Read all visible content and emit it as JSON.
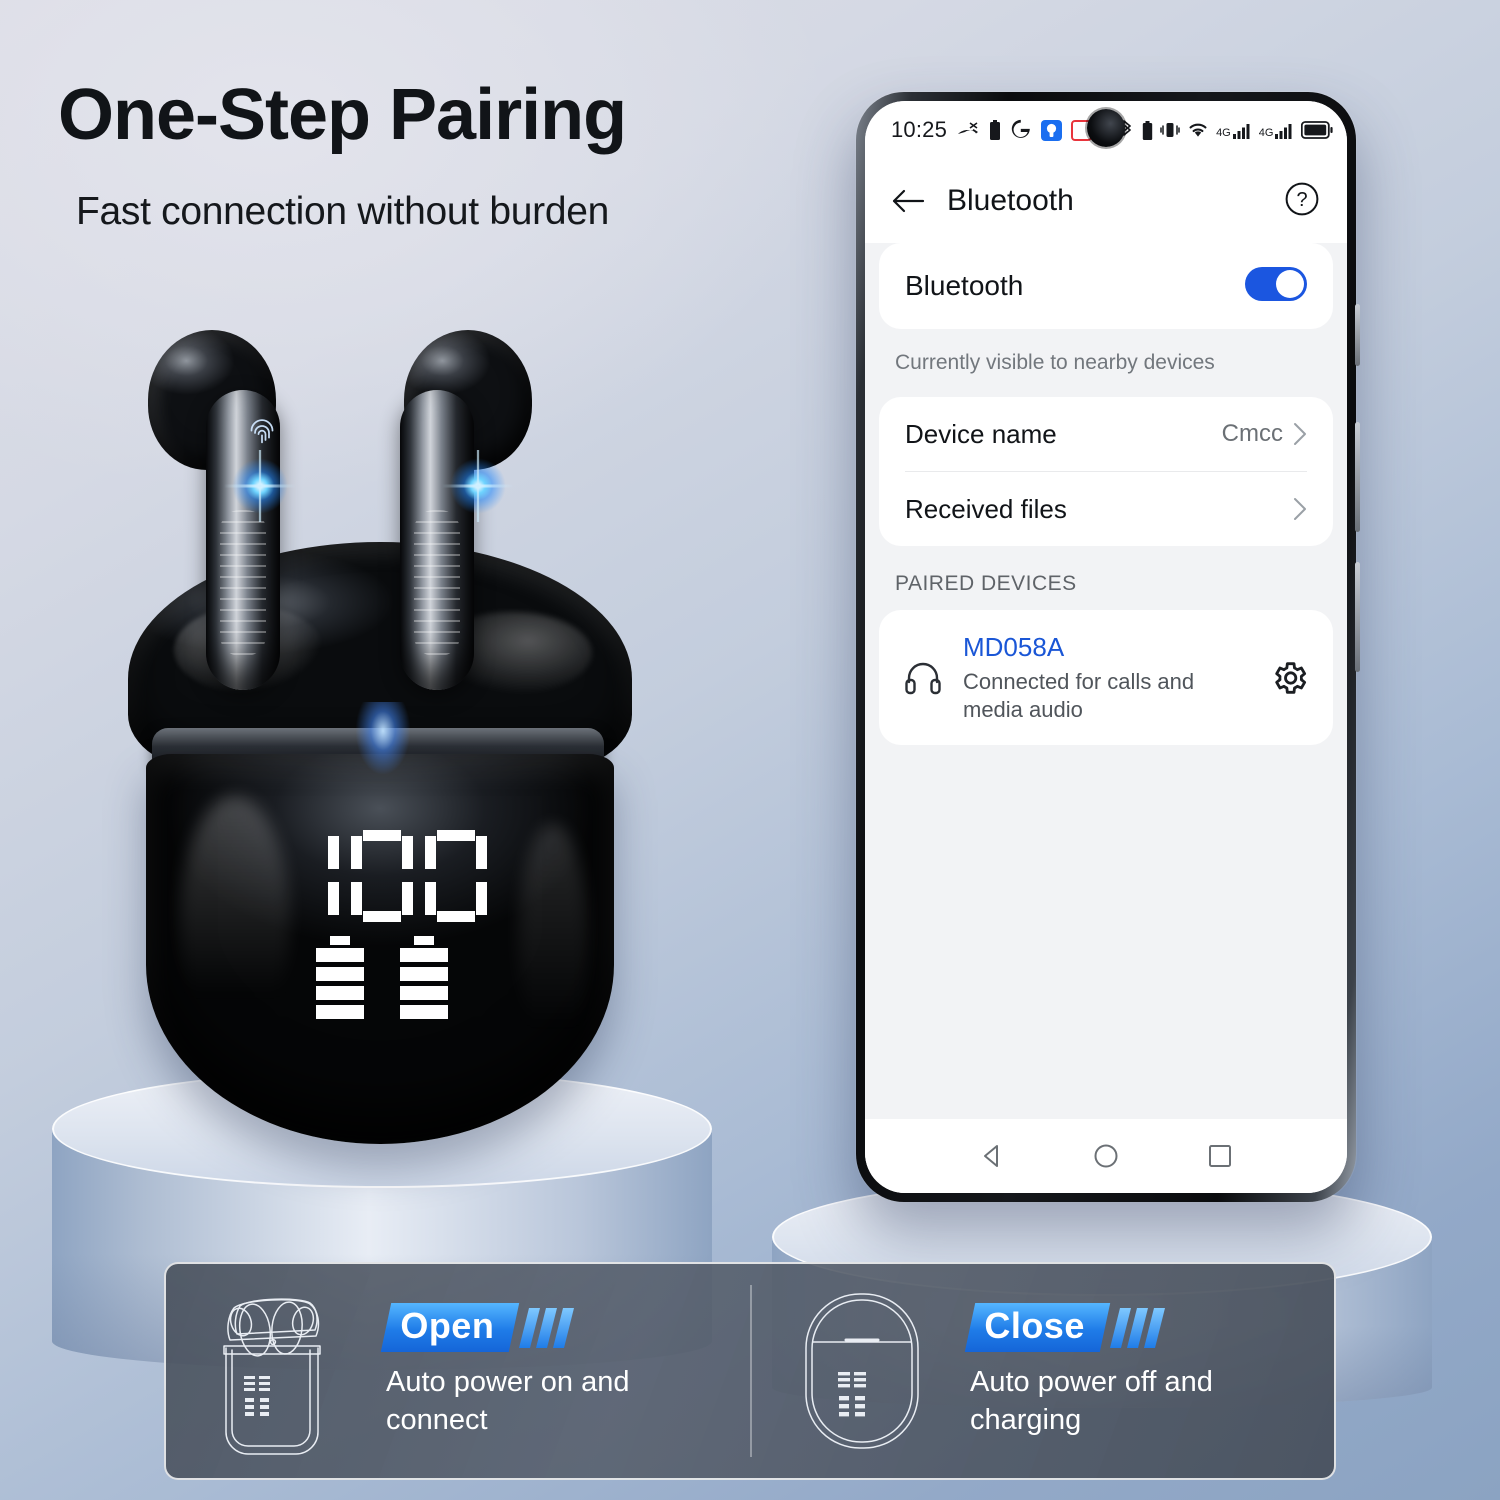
{
  "marketing": {
    "headline": "One-Step Pairing",
    "subheadline": "Fast connection without burden"
  },
  "product": {
    "led_display": {
      "digits": "100",
      "earbud_battery_bars": 4
    }
  },
  "phone": {
    "statusbar": {
      "time": "10:25",
      "left_icons": [
        "missed-call-icon",
        "battery-icon",
        "google-icon",
        "app-blue-icon",
        "app-red-icon",
        "more-icon"
      ],
      "right_icons": [
        "bluetooth-icon",
        "battery-small-icon",
        "vibrate-icon",
        "wifi-icon",
        "signal-4g-1-icon",
        "signal-4g-2-icon",
        "battery-full-icon"
      ],
      "network_label": "4G"
    },
    "appbar": {
      "back_label": "back-arrow",
      "title": "Bluetooth",
      "help_label": "?"
    },
    "settings": {
      "bluetooth_toggle_label": "Bluetooth",
      "bluetooth_enabled": true,
      "visibility_note": "Currently visible to nearby devices",
      "rows": [
        {
          "label": "Device name",
          "value": "Cmcc"
        },
        {
          "label": "Received files",
          "value": ""
        }
      ],
      "paired_section_title": "PAIRED DEVICES",
      "paired_devices": [
        {
          "name": "MD058A",
          "status": "Connected for calls and media audio",
          "icon": "headphones-icon",
          "action_icon": "gear-icon"
        }
      ]
    },
    "navbar": [
      "back-triangle-icon",
      "home-circle-icon",
      "recents-square-icon"
    ]
  },
  "features": [
    {
      "badge": "Open",
      "description": "Auto power on and connect",
      "art": "case-open-outline"
    },
    {
      "badge": "Close",
      "description": "Auto power off and charging",
      "art": "case-closed-outline"
    }
  ],
  "colors": {
    "accent_blue": "#1b56e0",
    "device_name_blue": "#1a56d6",
    "badge_blue": "#1f7ce8",
    "screen_bg": "#f2f3f5",
    "text_primary": "#111418",
    "text_secondary": "#6b7075"
  }
}
